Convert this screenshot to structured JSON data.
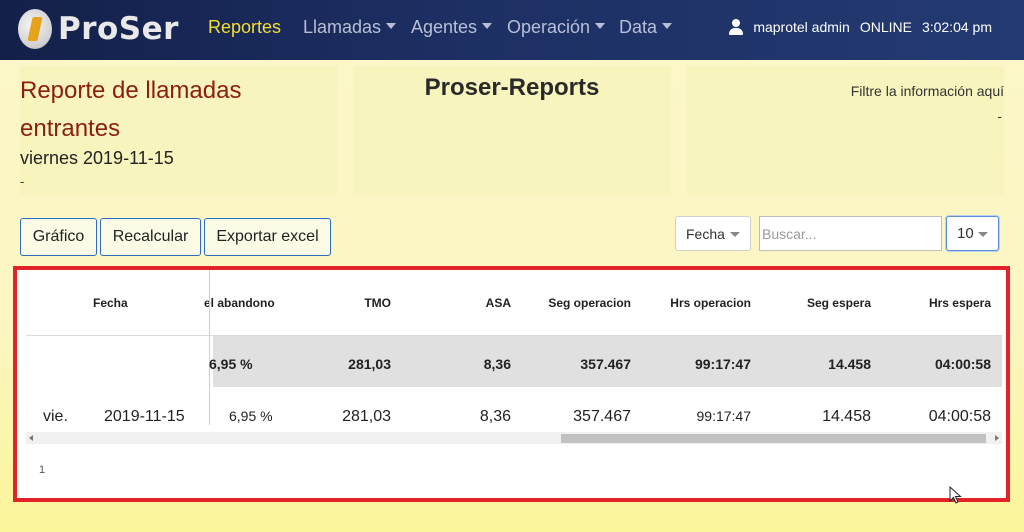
{
  "app": {
    "logo_text": "ProSer"
  },
  "nav": {
    "items": [
      {
        "label": "Reportes",
        "active": true
      },
      {
        "label": "Llamadas",
        "dropdown": true
      },
      {
        "label": "Agentes",
        "dropdown": true
      },
      {
        "label": "Operación",
        "dropdown": true
      },
      {
        "label": "Data",
        "dropdown": true
      }
    ],
    "user": "maprotel admin",
    "status": "ONLINE",
    "time": "3:02:04 pm"
  },
  "report": {
    "title": "Reporte de llamadas entrantes",
    "date": "viernes 2019-11-15",
    "dash": "-"
  },
  "center": {
    "title": "Proser-Reports"
  },
  "filter": {
    "label": "Filtre la información aquí",
    "dash": "-"
  },
  "toolbar": {
    "grafico": "Gráfico",
    "recalcular": "Recalcular",
    "exportar": "Exportar excel",
    "sort_select": "Fecha",
    "search_placeholder": "Buscar...",
    "page_size": "10"
  },
  "table": {
    "headers": [
      "Fecha",
      "el abandono",
      "TMO",
      "ASA",
      "Seg operacion",
      "Hrs operacion",
      "Seg espera",
      "Hrs espera"
    ],
    "totals": [
      "6,95 %",
      "281,03",
      "8,36",
      "357.467",
      "99:17:47",
      "14.458",
      "04:00:58"
    ],
    "rows": [
      {
        "day": "vie.",
        "date": "2019-11-15",
        "cells": [
          "6,95 %",
          "281,03",
          "8,36",
          "357.467",
          "99:17:47",
          "14.458",
          "04:00:58"
        ]
      }
    ]
  },
  "pager": {
    "page": "1"
  },
  "colors": {
    "nav_bg": "#1d2f63",
    "active_nav": "#f3de36",
    "title_red": "#8c1e10",
    "highlight_border": "#e3222a",
    "panel_bg": "#f7f4bd"
  }
}
